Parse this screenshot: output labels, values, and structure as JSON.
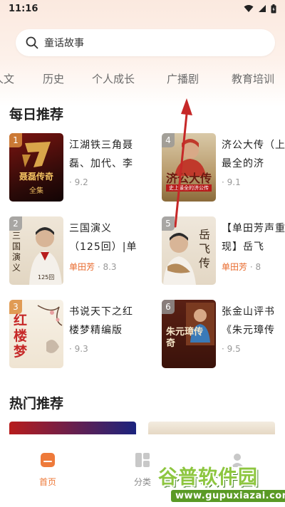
{
  "status_bar": {
    "time": "11:16"
  },
  "search": {
    "placeholder": "童话故事"
  },
  "categories": [
    "人文",
    "历史",
    "个人成长",
    "广播剧",
    "教育培训"
  ],
  "daily": {
    "title": "每日推荐",
    "books": [
      {
        "rank": "1",
        "title": "江湖铁三角聂磊、加代、李",
        "author": "",
        "rating": "9.2",
        "cover_text": "聂磊传奇",
        "cover_sub": "全集"
      },
      {
        "rank": "2",
        "title": "三国演义（125回）|单",
        "author": "单田芳",
        "rating": "8.3",
        "cover_text": "三国演义",
        "cover_sub": "125回"
      },
      {
        "rank": "3",
        "title": "书说天下之红楼梦精编版",
        "author": "",
        "rating": "9.3",
        "cover_text": "红楼梦",
        "cover_sub": ""
      },
      {
        "rank": "4",
        "title": "济公大传（上最全的济",
        "author": "",
        "rating": "9.1",
        "cover_text": "济公大传",
        "cover_sub": "史上最全的济公传"
      },
      {
        "rank": "5",
        "title": "【单田芳声重现】岳飞",
        "author": "单田芳",
        "rating": "8",
        "cover_text": "岳飞传",
        "cover_sub": ""
      },
      {
        "rank": "6",
        "title": "张金山评书《朱元璋传",
        "author": "",
        "rating": "9.5",
        "cover_text": "朱元璋传奇",
        "cover_sub": ""
      }
    ]
  },
  "hot": {
    "title": "热门推荐"
  },
  "nav": {
    "home": "首页",
    "category": "分类"
  },
  "watermark": {
    "title": "谷普软件园",
    "url": "www.gupuxiazai.com"
  },
  "colors": {
    "accent": "#e86a2c",
    "nav_active": "#ee7a3a"
  }
}
